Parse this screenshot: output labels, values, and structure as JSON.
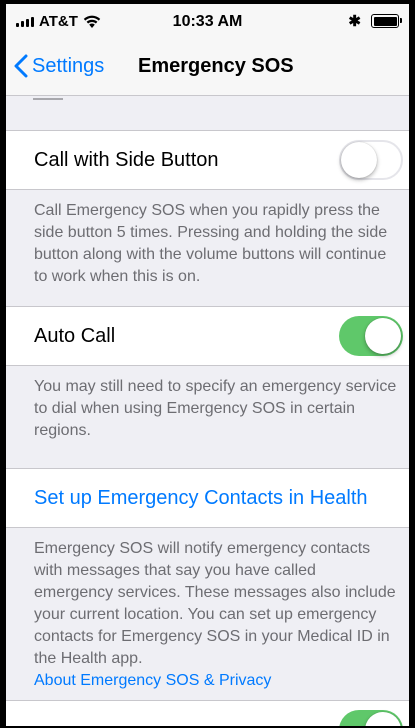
{
  "status_bar": {
    "carrier": "AT&T",
    "time": "10:33 AM",
    "bluetooth": "✱"
  },
  "nav": {
    "back_label": "Settings",
    "title": "Emergency SOS"
  },
  "sections": {
    "side_button": {
      "label": "Call with Side Button",
      "enabled": false,
      "footer": "Call Emergency SOS when you rapidly press the side button 5 times. Pressing and holding the side button along with the volume buttons will continue to work when this is on."
    },
    "auto_call": {
      "label": "Auto Call",
      "enabled": true,
      "footer": "You may still need to specify an emergency service to dial when using Emergency SOS in certain regions."
    },
    "contacts": {
      "link_label": "Set up Emergency Contacts in Health",
      "footer": "Emergency SOS will notify emergency contacts with messages that say you have called emergency services. These messages also include your current location. You can set up emergency contacts for Emergency SOS in your Medical ID in the Health app.",
      "footer_link": "About Emergency SOS & Privacy"
    }
  },
  "colors": {
    "accent": "#007aff",
    "toggle_on": "#5fc86a",
    "group_background": "#efeff4",
    "footer_text": "#6d6d72"
  },
  "icons": {
    "back": "chevron-left-icon",
    "signal": "signal-bars-icon",
    "wifi": "wifi-icon",
    "bluetooth": "bluetooth-icon",
    "battery": "battery-icon"
  }
}
